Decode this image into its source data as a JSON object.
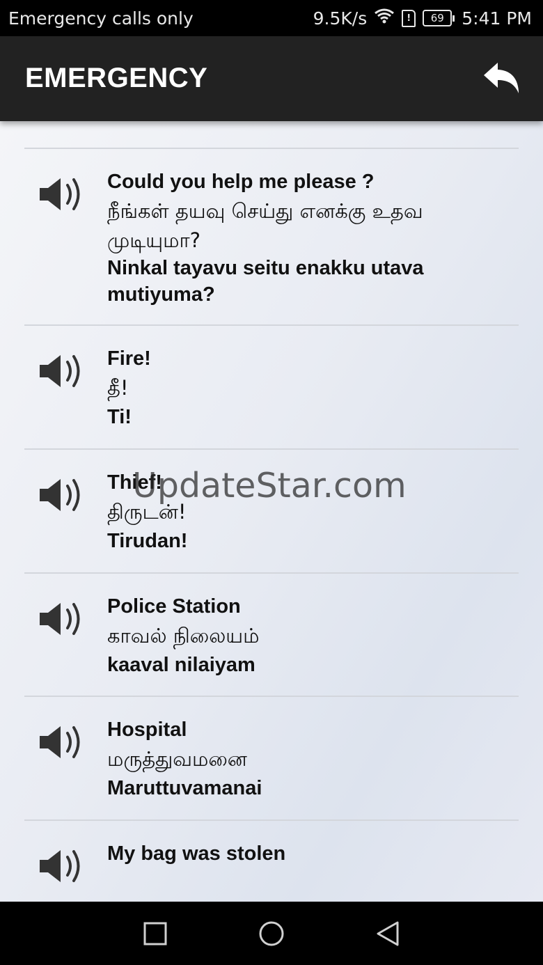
{
  "status_bar": {
    "carrier": "Emergency calls only",
    "speed": "9.5K/s",
    "battery": "69",
    "time": "5:41 PM"
  },
  "app_bar": {
    "title": "EMERGENCY",
    "back_icon": "reply-arrow-icon"
  },
  "watermark": "UpdateStar.com",
  "phrases": [
    {
      "english": "Could you help me please ?",
      "tamil": "நீங்கள் தயவு செய்து எனக்கு உதவ முடியுமா?",
      "transliteration": "Ninkal tayavu seitu enakku utava mutiyuma?"
    },
    {
      "english": "Fire!",
      "tamil": "தீ!",
      "transliteration": "Ti!"
    },
    {
      "english": "Thief!",
      "tamil": "திருடன்!",
      "transliteration": "Tirudan!"
    },
    {
      "english": "Police Station",
      "tamil": "காவல் நிலையம்",
      "transliteration": "kaaval nilaiyam"
    },
    {
      "english": "Hospital",
      "tamil": "மருத்துவமனை",
      "transliteration": "Maruttuvamanai"
    },
    {
      "english": "My bag was stolen",
      "tamil": "",
      "transliteration": ""
    }
  ],
  "nav": {
    "recents_icon": "square-recents-icon",
    "home_icon": "circle-home-icon",
    "back_icon": "triangle-back-icon"
  }
}
